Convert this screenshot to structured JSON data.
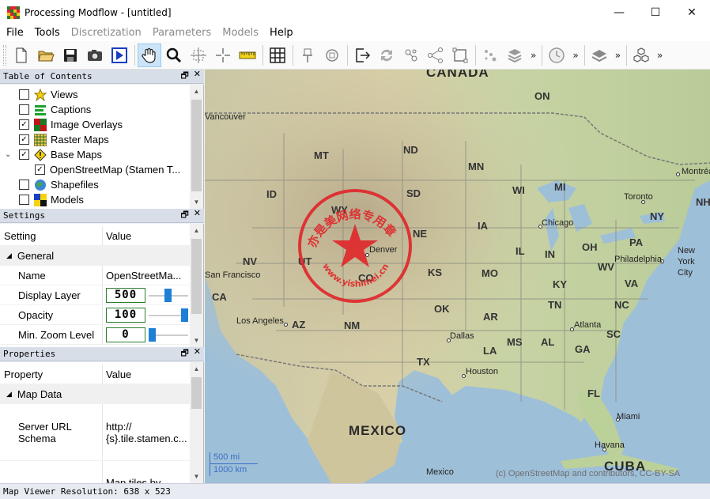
{
  "window": {
    "title": "Processing Modflow - [untitled]",
    "minimize": "—",
    "maximize": "☐",
    "close": "✕"
  },
  "menu": [
    {
      "label": "File",
      "enabled": true
    },
    {
      "label": "Tools",
      "enabled": true
    },
    {
      "label": "Discretization",
      "enabled": false
    },
    {
      "label": "Parameters",
      "enabled": false
    },
    {
      "label": "Models",
      "enabled": false
    },
    {
      "label": "Help",
      "enabled": true
    }
  ],
  "toolbar": {
    "overflow": "»"
  },
  "toc": {
    "title": "Table of Contents",
    "float": "🗗",
    "close": "✕",
    "items": [
      {
        "label": "Views",
        "checked": false,
        "icon": "star-icon"
      },
      {
        "label": "Captions",
        "checked": false,
        "icon": "captions-icon"
      },
      {
        "label": "Image Overlays",
        "checked": true,
        "icon": "image-overlay-icon"
      },
      {
        "label": "Raster Maps",
        "checked": true,
        "icon": "raster-map-icon"
      },
      {
        "label": "Base Maps",
        "checked": true,
        "icon": "base-map-icon",
        "expanded": true
      },
      {
        "label": "OpenStreetMap (Stamen T...",
        "checked": true,
        "child": true
      },
      {
        "label": "Shapefiles",
        "checked": false,
        "icon": "globe-icon"
      },
      {
        "label": "Models",
        "checked": false,
        "icon": "models-icon"
      }
    ]
  },
  "settings": {
    "title": "Settings",
    "float": "🗗",
    "close": "✕",
    "col_setting": "Setting",
    "col_value": "Value",
    "category": "General",
    "rows": {
      "name_label": "Name",
      "name_value": "OpenStreetMa...",
      "layer_label": "Display Layer",
      "layer_value": "500",
      "opacity_label": "Opacity",
      "opacity_value": "100",
      "zoom_label": "Min. Zoom Level",
      "zoom_value": "0"
    }
  },
  "properties": {
    "title": "Properties",
    "float": "🗗",
    "close": "✕",
    "col_property": "Property",
    "col_value": "Value",
    "category": "Map Data",
    "server_label_1": "Server URL",
    "server_label_2": "Schema",
    "server_value_1": "http://",
    "server_value_2": "{s}.tile.stamen.c...",
    "tiles_value": "Map tiles by"
  },
  "map": {
    "countries": [
      "CANADA",
      "MEXICO",
      "CUBA"
    ],
    "states": [
      "ON",
      "MT",
      "ND",
      "MN",
      "SD",
      "WI",
      "MI",
      "ID",
      "WY",
      "IA",
      "NE",
      "NY",
      "PA",
      "OH",
      "IN",
      "IL",
      "NV",
      "UT",
      "CO",
      "KS",
      "MO",
      "KY",
      "WV",
      "VA",
      "CA",
      "OK",
      "AR",
      "TN",
      "NC",
      "AZ",
      "NM",
      "SC",
      "MS",
      "AL",
      "GA",
      "LA",
      "TX",
      "FL",
      "NH"
    ],
    "cities": [
      "Montréal",
      "Toronto",
      "Chicago",
      "Denver",
      "Philadelphia",
      "New York City",
      "Los Angeles",
      "Dallas",
      "Atlanta",
      "Houston",
      "Miami",
      "Havana",
      "Mexico",
      "San Francisco",
      "Vancouver"
    ],
    "scale_mi": "500 mi",
    "scale_km": "1000 km",
    "attribution": "(c) OpenStreetMap and contributors, CC-BY-SA",
    "stamp_url": "www.yishimei.cn",
    "stamp_text": "亦是美网络专用章"
  },
  "status": {
    "text": "Map Viewer Resolution: 638 x 523"
  }
}
